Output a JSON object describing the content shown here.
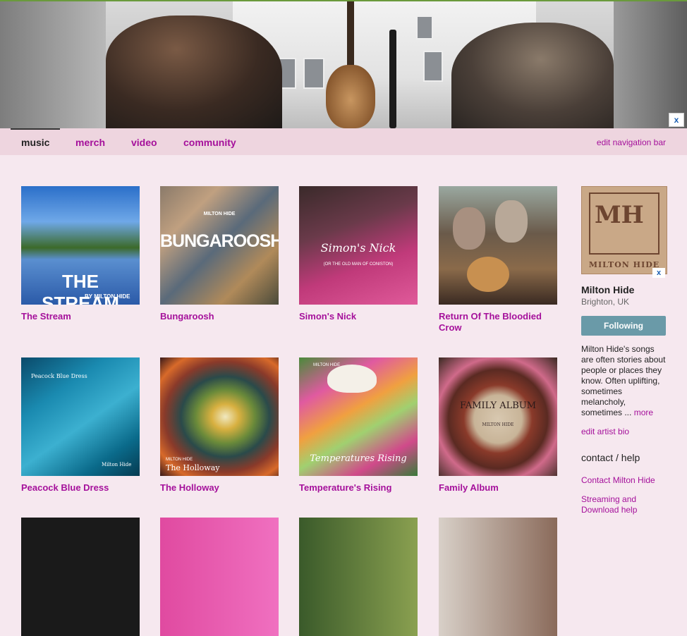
{
  "banner": {
    "close_label": "x"
  },
  "nav": {
    "tabs": [
      {
        "label": "music",
        "active": true
      },
      {
        "label": "merch",
        "active": false
      },
      {
        "label": "video",
        "active": false
      },
      {
        "label": "community",
        "active": false
      }
    ],
    "edit_label": "edit navigation bar"
  },
  "albums": [
    {
      "title": "The Stream",
      "cover_text": "THE STREAM",
      "cover_sub": "BY MILTON HIDE"
    },
    {
      "title": "Bungaroosh",
      "cover_text": "BUNGAROOSH",
      "cover_sub": "MILTON HIDE"
    },
    {
      "title": "Simon's Nick",
      "cover_text": "Simon's Nick",
      "cover_sub": "(OR THE OLD MAN OF CONISTON)"
    },
    {
      "title": "Return Of The Bloodied Crow"
    },
    {
      "title": "Peacock Blue Dress",
      "cover_text": "Peacock Blue Dress",
      "cover_sub": "Milton Hide"
    },
    {
      "title": "The Holloway",
      "cover_text": "The Holloway",
      "cover_sub": "MILTON HIDE"
    },
    {
      "title": "Temperature's Rising",
      "cover_text": "Temperatures Rising",
      "cover_sub": "MILTON HIDE"
    },
    {
      "title": "Family Album",
      "cover_text": "FAMILY ALBUM",
      "cover_sub": "MILTON HIDE"
    }
  ],
  "sidebar": {
    "logo_monogram": "MH",
    "logo_text": "MILTON HIDE",
    "close_label": "x",
    "artist_name": "Milton Hide",
    "location": "Brighton, UK",
    "follow_label": "Following",
    "bio": "Milton Hide's songs are often stories about people or places they know. Often uplifting, sometimes melancholy, sometimes ...",
    "bio_more": "more",
    "edit_bio": "edit artist bio",
    "contact_heading": "contact / help",
    "contact_link": "Contact Milton Hide",
    "help_link": "Streaming and Download help"
  },
  "colors": {
    "link": "#a5109b",
    "background": "#f6e8ef",
    "navbar": "#eed5df",
    "follow_button": "#6a9aa8"
  }
}
